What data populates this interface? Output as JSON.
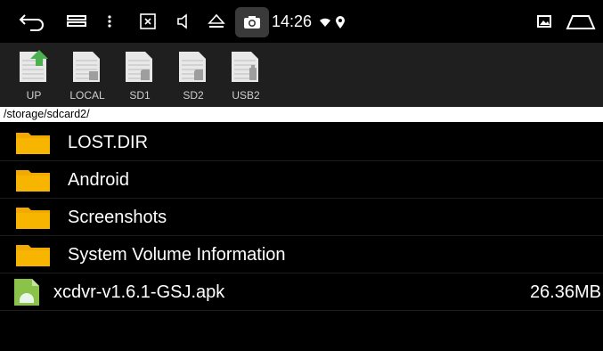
{
  "statusbar": {
    "time": "14:26",
    "icons": [
      "back-icon",
      "recents-icon",
      "more-icon",
      "screenshot-close-icon",
      "volume-icon",
      "eject-icon",
      "camera-icon",
      "wifi-icon",
      "location-icon",
      "gallery-icon",
      "home-icon"
    ]
  },
  "toolbar": {
    "items": [
      {
        "label": "UP",
        "icon": "up-folder-icon"
      },
      {
        "label": "LOCAL",
        "icon": "storage-icon"
      },
      {
        "label": "SD1",
        "icon": "sdcard-icon"
      },
      {
        "label": "SD2",
        "icon": "sdcard-icon"
      },
      {
        "label": "USB2",
        "icon": "usb-icon"
      }
    ]
  },
  "path": "/storage/sdcard2/",
  "files": [
    {
      "name": "LOST.DIR",
      "type": "folder",
      "size": ""
    },
    {
      "name": "Android",
      "type": "folder",
      "size": ""
    },
    {
      "name": "Screenshots",
      "type": "folder",
      "size": ""
    },
    {
      "name": "System Volume Information",
      "type": "folder",
      "size": ""
    },
    {
      "name": "xcdvr-v1.6.1-GSJ.apk",
      "type": "apk",
      "size": "26.36MB"
    }
  ],
  "colors": {
    "folder": "#f2a900",
    "toolbar_bg": "#1f1f1f",
    "apk_green": "#8bc34a"
  }
}
